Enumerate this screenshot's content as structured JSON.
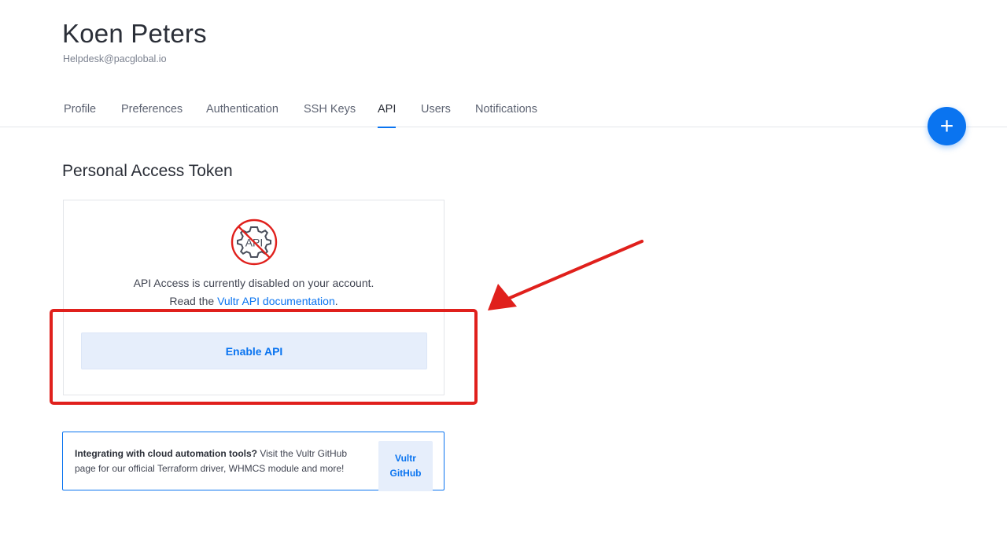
{
  "user": {
    "name": "Koen Peters",
    "email": "Helpdesk@pacglobal.io"
  },
  "tabs": [
    {
      "label": "Profile",
      "active": false
    },
    {
      "label": "Preferences",
      "active": false
    },
    {
      "label": "Authentication",
      "active": false
    },
    {
      "label": "SSH Keys",
      "active": false
    },
    {
      "label": "API",
      "active": true
    },
    {
      "label": "Users",
      "active": false
    },
    {
      "label": "Notifications",
      "active": false
    }
  ],
  "fab": {
    "icon": "plus-icon",
    "label": "+"
  },
  "section": {
    "title": "Personal Access Token"
  },
  "token_card": {
    "icon": "api-disabled-icon",
    "icon_text": "API",
    "disabled_message": "API Access is currently disabled on your account.",
    "doc_prefix": "Read the ",
    "doc_link": "Vultr API documentation",
    "doc_suffix": ".",
    "enable_button": "Enable API"
  },
  "info_box": {
    "bold": "Integrating with cloud automation tools?",
    "text": " Visit the Vultr GitHub page for our official Terraform driver, WHMCS module and more!",
    "button": "Vultr GitHub"
  },
  "colors": {
    "accent": "#0a74f0",
    "annotation": "#e0201c",
    "button_bg": "#e6eefb"
  }
}
